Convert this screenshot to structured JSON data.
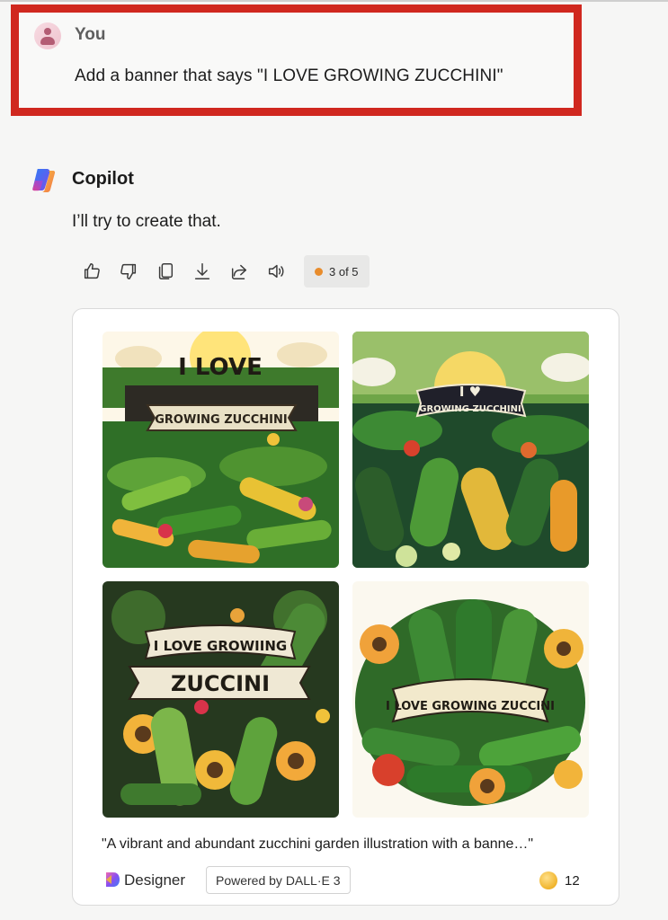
{
  "user_message": {
    "sender": "You",
    "text": "Add a banner that says \"I LOVE GROWING ZUCCHINI\""
  },
  "copilot_message": {
    "sender": "Copilot",
    "text": "I’ll try to create that.",
    "actions": [
      "thumbs-up-icon",
      "thumbs-down-icon",
      "copy-icon",
      "download-icon",
      "share-icon",
      "speaker-icon"
    ],
    "page_indicator": "3 of 5"
  },
  "image_card": {
    "images": [
      {
        "banner_top": "I LOVE",
        "banner_main": "GROWING ZUCCHINI"
      },
      {
        "banner_top": "I ♥",
        "banner_main": "GROWING ZUCCHINI"
      },
      {
        "banner_top": "I LOVE GROWIING",
        "banner_main": "ZUCCINI"
      },
      {
        "banner_top": "",
        "banner_main": "I LOVE GROWING ZUCCINI"
      }
    ],
    "caption": "\"A vibrant and abundant zucchini garden illustration with a banne…\"",
    "designer_label": "Designer",
    "powered_by": "Powered by DALL·E 3",
    "boost_count": "12"
  },
  "colors": {
    "highlight_frame": "#d0281f",
    "page_dot": "#e88c2c",
    "background": "#f6f6f5"
  }
}
